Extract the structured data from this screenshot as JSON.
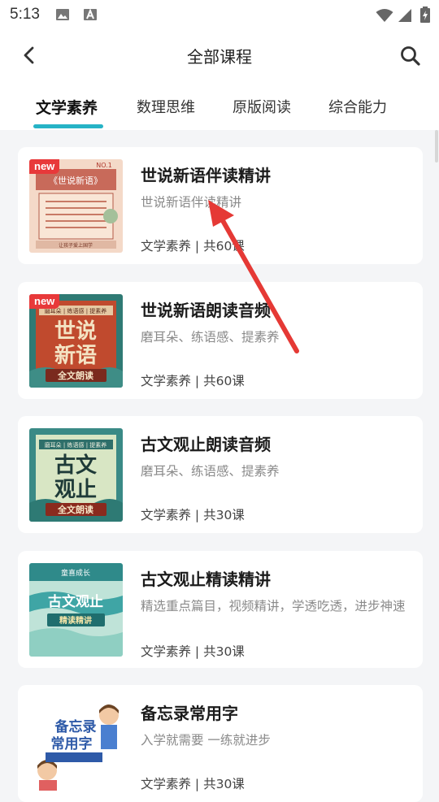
{
  "status_bar": {
    "time": "5:13"
  },
  "header": {
    "title": "全部课程"
  },
  "tabs": [
    {
      "label": "文学素养",
      "active": true
    },
    {
      "label": "数理思维",
      "active": false
    },
    {
      "label": "原版阅读",
      "active": false
    },
    {
      "label": "综合能力",
      "active": false
    }
  ],
  "courses": [
    {
      "title": "世说新语伴读精讲",
      "desc": "世说新语伴读精讲",
      "meta": "文学素养 | 共60课",
      "badge": "new",
      "thumb": {
        "top_text": "《世说新语》",
        "corner_text": "NO.1",
        "bottom_text": "让孩子爱上国学"
      }
    },
    {
      "title": "世说新语朗读音频",
      "desc": "磨耳朵、练语感、提素养",
      "meta": "文学素养 | 共60课",
      "badge": "new",
      "thumb": {
        "tag_text": "磨耳朵 | 练语感 | 提素养",
        "main1": "世说",
        "main2": "新语",
        "plaque": "全文朗读"
      }
    },
    {
      "title": "古文观止朗读音频",
      "desc": "磨耳朵、练语感、提素养",
      "meta": "文学素养 | 共30课",
      "badge": "",
      "thumb": {
        "tag_text": "磨耳朵 | 练语感 | 提素养",
        "main1": "古文",
        "main2": "观止",
        "plaque": "全文朗读"
      }
    },
    {
      "title": "古文观止精读精讲",
      "desc": "精选重点篇目，视频精讲，学透吃透，进步神速",
      "meta": "文学素养 | 共30课",
      "badge": "",
      "thumb": {
        "tag_text": "童喜成长",
        "main1": "古文观止",
        "plaque": "精读精讲"
      }
    },
    {
      "title": "备忘录常用字",
      "desc": "入学就需要 一练就进步",
      "meta": "文学素养 | 共30课",
      "badge": "",
      "thumb": {
        "main1": "备忘录",
        "main2": "常用字"
      }
    }
  ],
  "colors": {
    "accent": "#26b3c6",
    "badge": "#e8393a",
    "arrow": "#e53935"
  }
}
